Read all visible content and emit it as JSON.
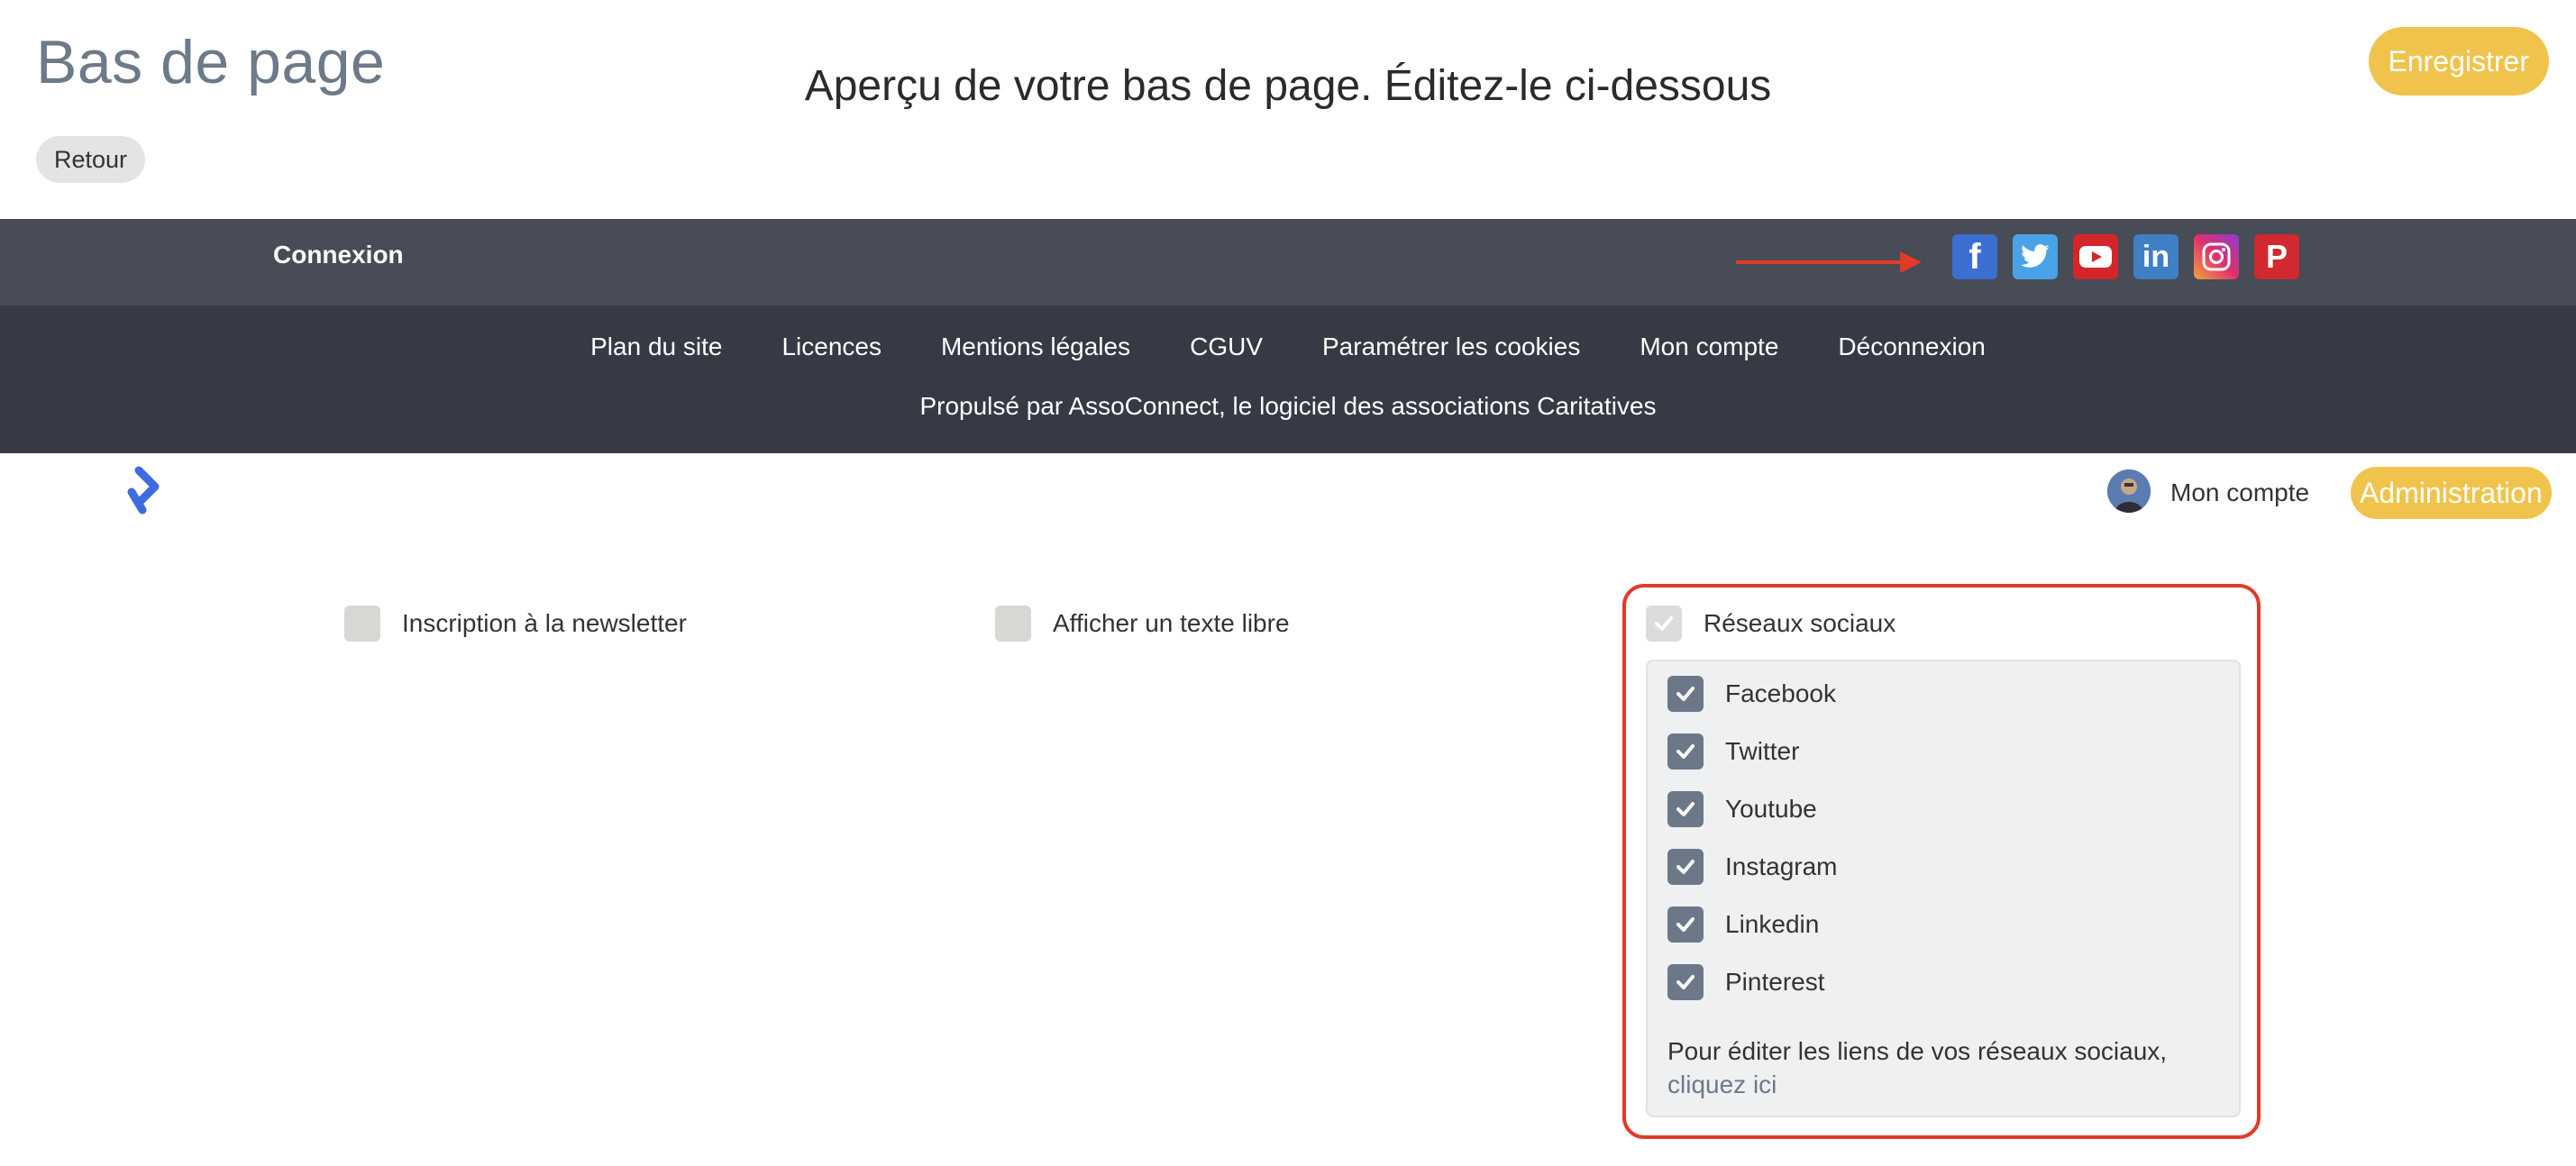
{
  "header": {
    "title": "Bas de page",
    "back_label": "Retour",
    "preview_heading": "Aperçu de votre bas de page. Éditez-le ci-dessous",
    "save_label": "Enregistrer"
  },
  "footer_preview": {
    "login_label": "Connexion",
    "social_icons": [
      "facebook-icon",
      "twitter-icon",
      "youtube-icon",
      "linkedin-icon",
      "instagram-icon",
      "pinterest-icon"
    ],
    "links": [
      "Plan du site",
      "Licences",
      "Mentions légales",
      "CGUV",
      "Paramétrer les cookies",
      "Mon compte",
      "Déconnexion"
    ],
    "powered_by": "Propulsé par AssoConnect, le logiciel des associations Caritatives"
  },
  "admin_bar": {
    "account_label": "Mon compte",
    "admin_label": "Administration"
  },
  "options": {
    "newsletter": "Inscription à la newsletter",
    "free_text": "Afficher un texte libre",
    "social": "Réseaux sociaux"
  },
  "social_networks": {
    "items": [
      "Facebook",
      "Twitter",
      "Youtube",
      "Instagram",
      "Linkedin",
      "Pinterest"
    ],
    "edit_text": "Pour éditer les liens de vos réseaux sociaux,",
    "edit_link": "cliquez ici"
  },
  "colors": {
    "accent": "#f0c44c",
    "title": "#6c7a89",
    "footer_top": "#474c56",
    "footer_bottom": "#353a44",
    "highlight": "#e23a28"
  }
}
